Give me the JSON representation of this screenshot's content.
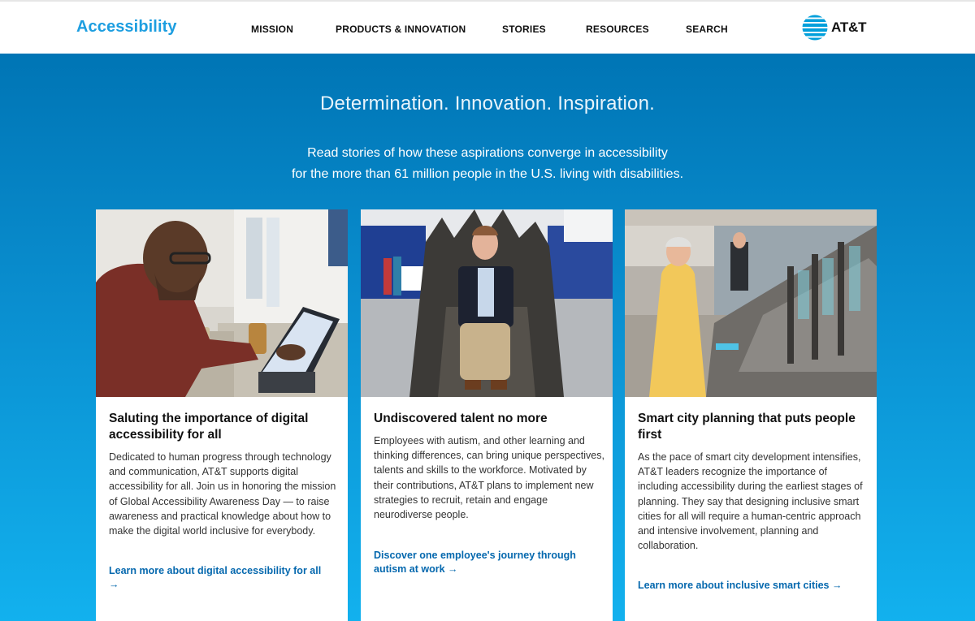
{
  "header": {
    "brand": "Accessibility",
    "nav": [
      "MISSION",
      "PRODUCTS & INNOVATION",
      "STORIES",
      "RESOURCES",
      "SEARCH"
    ],
    "logo_text": "AT&T"
  },
  "hero": {
    "title": "Determination. Innovation. Inspiration.",
    "subtitle_line1": "Read stories of how these aspirations converge in accessibility",
    "subtitle_line2": "for the more than 61 million people in the U.S. living with disabilities."
  },
  "cards": [
    {
      "title": "Saluting the importance of digital accessibility for all",
      "body": "Dedicated to human progress through technology and communication, AT&T supports digital accessibility for all. Join us in honoring the mission of Global Accessibility Awareness Day — to raise awareness and practical knowledge about how to make the digital world inclusive for everybody.",
      "link": "Learn more about digital accessibility for all →"
    },
    {
      "title": "Undiscovered talent no more",
      "body": "Employees with autism, and other learning and thinking differences, can bring unique perspectives, talents and skills to the workforce. Motivated by their contributions, AT&T plans to implement new strategies to recruit, retain and engage neurodiverse people.",
      "link": "Discover one employee's journey through autism at work →"
    },
    {
      "title": "Smart city planning that puts people first",
      "body": "As the pace of smart city development intensifies, AT&T leaders recognize the importance of including accessibility during the earliest stages of planning. They say that designing inclusive smart cities for all will require a human-centric approach and intensive involvement, planning and collaboration.",
      "link": "Learn more about inclusive smart cities →"
    }
  ],
  "colors": {
    "brand": "#1d9ee0",
    "link": "#0568ae",
    "hero_top": "#0075b5",
    "hero_bottom": "#12b1ee"
  },
  "icons": [
    "att-globe-icon"
  ]
}
